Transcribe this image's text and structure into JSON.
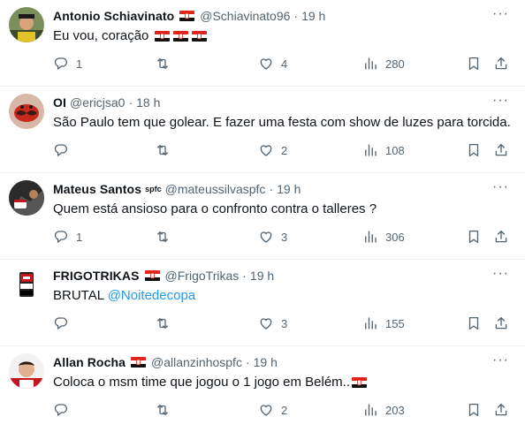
{
  "tweets": [
    {
      "name": "Antonio Schiavinato",
      "handle": "@Schiavinato96",
      "time": "19 h",
      "name_flag": true,
      "sup": "",
      "text_before": "Eu vou, coração ",
      "mention": "",
      "text_flags": 3,
      "replies": "1",
      "retweets": "",
      "likes": "4",
      "views": "280",
      "avatar": "avatar-antonio"
    },
    {
      "name": "OI",
      "handle": "@ericjsa0",
      "time": "18 h",
      "name_flag": false,
      "sup": "",
      "text_before": "São Paulo tem que golear. E fazer uma festa com show de luzes para torcida.",
      "mention": "",
      "text_flags": 0,
      "replies": "",
      "retweets": "",
      "likes": "2",
      "views": "108",
      "avatar": "avatar-oi"
    },
    {
      "name": "Mateus Santos",
      "handle": "@mateussilvaspfc",
      "time": "19 h",
      "name_flag": false,
      "sup": "spfc",
      "text_before": "Quem está ansioso para o confronto contra o talleres ?",
      "mention": "",
      "text_flags": 0,
      "replies": "1",
      "retweets": "",
      "likes": "3",
      "views": "306",
      "avatar": "avatar-mateus"
    },
    {
      "name": "FRIGOTRIKAS",
      "handle": "@FrigoTrikas",
      "time": "19 h",
      "name_flag": true,
      "sup": "",
      "text_before": "BRUTAL ",
      "mention": "@Noitedecopa",
      "text_flags": 0,
      "replies": "",
      "retweets": "",
      "likes": "3",
      "views": "155",
      "avatar": "avatar-frigotrikas"
    },
    {
      "name": "Allan Rocha",
      "handle": "@allanzinhospfc",
      "time": "19 h",
      "name_flag": true,
      "sup": "",
      "text_before": "Coloca o msm time que jogou o 1 jogo em Belém..",
      "mention": "",
      "text_flags": 1,
      "replies": "",
      "retweets": "",
      "likes": "2",
      "views": "203",
      "avatar": "avatar-allan"
    }
  ],
  "colors": {
    "text": "#0f1419",
    "secondary": "#536471",
    "link": "#1d9bf0",
    "flag_red": "#e2231a",
    "flag_black": "#111111"
  },
  "icons": [
    "reply-icon",
    "retweet-icon",
    "like-icon",
    "views-icon",
    "bookmark-icon",
    "share-icon",
    "more-icon",
    "spfc-flag-icon"
  ]
}
